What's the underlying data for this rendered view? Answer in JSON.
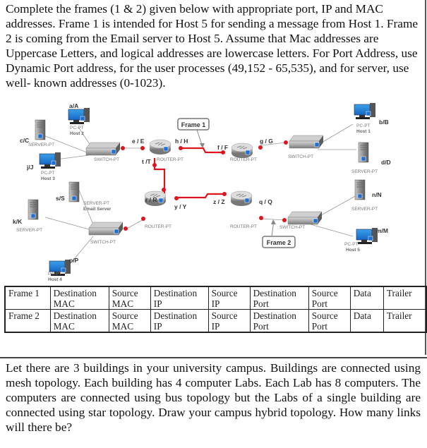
{
  "question1": {
    "text": "Complete the frames (1 & 2) given below with appropriate port, IP and MAC addresses. Frame 1 is intended for Host 5 for sending a message from Host 1. Frame 2 is coming from the Email server to Host 5. Assume that Mac addresses are Uppercase Letters, and logical addresses are lowercase letters. For Port Address, use Dynamic Port address, for the user processes (49,152 - 65,535), and for server, use well- known addresses (0-1023)."
  },
  "diagram": {
    "callouts": {
      "frame1": "Frame 1",
      "frame2": "Frame 2"
    },
    "devices": {
      "host2": {
        "addr": "a/A",
        "type": "PC-PT",
        "name": "Host 2"
      },
      "server_c": {
        "addr": "c/C",
        "type": "SERVER-PT"
      },
      "host3": {
        "addr": "j/J",
        "type": "PC-PT",
        "name": "Host 3"
      },
      "switch1": {
        "type": "SWITCH-PT"
      },
      "router1": {
        "type": "ROUTER-PT"
      },
      "router2": {
        "type": "ROUTER-PT"
      },
      "switch2": {
        "type": "SWITCH-PT"
      },
      "host1": {
        "addr": "b/B",
        "type": "PC-PT",
        "name": "Host 1"
      },
      "server_d": {
        "addr": "d/D",
        "type": "SERVER-PT"
      },
      "email_server": {
        "addr": "s/S",
        "type": "SERVER-PT",
        "name": "Email Server"
      },
      "server_k": {
        "addr": "k/K",
        "type": "SERVER-PT"
      },
      "switch3": {
        "type": "SWITCH-PT"
      },
      "host4": {
        "addr": "p/P",
        "type": "PC-PT",
        "name": "Host 4"
      },
      "router3": {
        "type": "ROUTER-PT"
      },
      "router4": {
        "type": "ROUTER-PT"
      },
      "switch4": {
        "type": "SWITCH-PT"
      },
      "server_n": {
        "addr": "n/N",
        "type": "SERVER-PT"
      },
      "host5": {
        "addr": "m/M",
        "type": "PC-PT",
        "name": "Host 5"
      }
    },
    "interfaces": {
      "e": "e / E",
      "h": "h / H",
      "t": "t /T",
      "f": "f / F",
      "g": "g / G",
      "r": "r / R",
      "y": "y / Y",
      "z": "z / Z",
      "q": "q / Q"
    }
  },
  "frames_table": {
    "rows": [
      {
        "label": "Frame 1",
        "cells": [
          [
            "Destination",
            "MAC"
          ],
          [
            "Source",
            "MAC"
          ],
          [
            "Destination",
            "IP"
          ],
          [
            "Source",
            "IP"
          ],
          [
            "Destination",
            "Port"
          ],
          [
            "Source",
            "Port"
          ],
          [
            "Data",
            ""
          ],
          [
            "Trailer",
            ""
          ]
        ]
      },
      {
        "label": "Frame 2",
        "cells": [
          [
            "Destination",
            "MAC"
          ],
          [
            "Source",
            "MAC"
          ],
          [
            "Destination",
            "IP"
          ],
          [
            "Source",
            "IP"
          ],
          [
            "Destination",
            "Port"
          ],
          [
            "Source",
            "Port"
          ],
          [
            "Data",
            ""
          ],
          [
            "Trailer",
            ""
          ]
        ]
      }
    ]
  },
  "question2": {
    "text": "Let there are 3 buildings in your university campus. Buildings are connected using mesh topology. Each building has 4 computer Labs. Each Lab has 8 computers. The computers are connected using bus topology but the Labs of a single building are connected using star topology. Draw your campus hybrid topology. How many links will there be?"
  }
}
